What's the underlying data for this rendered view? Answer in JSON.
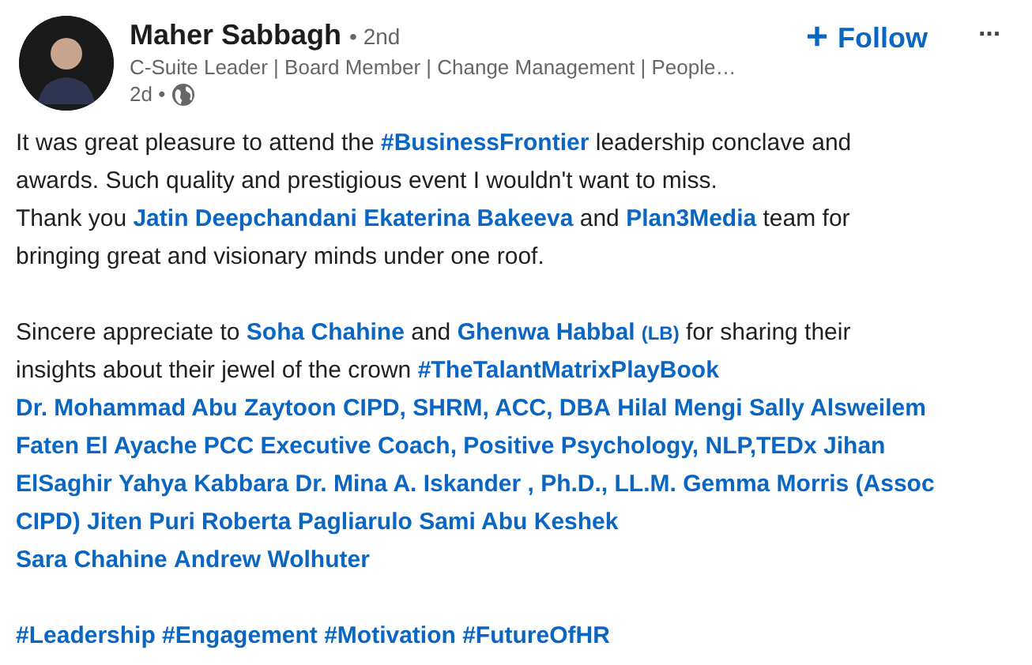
{
  "author": {
    "name": "Maher Sabbagh",
    "degree": "• 2nd",
    "headline": "C-Suite Leader | Board Member | Change Management | People…",
    "time": "2d •"
  },
  "follow": {
    "plus": "+",
    "label": "Follow"
  },
  "more": "···",
  "paragraphs": [
    {
      "lines": [
        [
          {
            "kind": "text",
            "text": "It was great pleasure to attend the "
          },
          {
            "kind": "link",
            "text": "#BusinessFrontier"
          },
          {
            "kind": "text",
            "text": " leadership conclave and"
          }
        ],
        [
          {
            "kind": "text",
            "text": "awards. Such quality and prestigious event I wouldn't want to miss."
          }
        ],
        [
          {
            "kind": "text",
            "text": "Thank you "
          },
          {
            "kind": "link",
            "text": "Jatin Deepchandani"
          },
          {
            "kind": "link",
            "text": "Ekaterina Bakeeva"
          },
          {
            "kind": "text",
            "text": " and "
          },
          {
            "kind": "link",
            "text": "Plan3Media"
          },
          {
            "kind": "text",
            "text": " team for"
          }
        ],
        [
          {
            "kind": "text",
            "text": "bringing great and visionary minds under one roof."
          }
        ]
      ]
    },
    {
      "lines": [
        [
          {
            "kind": "text",
            "text": "Sincere appreciate to "
          },
          {
            "kind": "link",
            "text": "Soha Chahine"
          },
          {
            "kind": "text",
            "text": " and "
          },
          {
            "kind": "link",
            "text": "Ghenwa Habbal"
          },
          {
            "kind": "badge",
            "text": "(LB)"
          },
          {
            "kind": "text",
            "text": " for sharing their"
          }
        ],
        [
          {
            "kind": "text",
            "text": "insights about their jewel of the crown "
          },
          {
            "kind": "link",
            "text": "#TheTalantMatrixPlayBook"
          }
        ],
        [
          {
            "kind": "link",
            "text": "Dr. Mohammad Abu Zaytoon CIPD, SHRM, ACC, DBA"
          },
          {
            "kind": "link",
            "text": "Hilal Mengi"
          },
          {
            "kind": "link",
            "text": "Sally Alsweilem"
          }
        ],
        [
          {
            "kind": "link",
            "text": "Faten El Ayache PCC Executive Coach, Positive Psychology, NLP,TEDx"
          },
          {
            "kind": "link",
            "text": "Jihan"
          }
        ],
        [
          {
            "kind": "link",
            "text": "ElSaghir"
          },
          {
            "kind": "link",
            "text": "Yahya Kabbara"
          },
          {
            "kind": "link",
            "text": "Dr. Mina A. Iskander , Ph.D., LL.M."
          },
          {
            "kind": "link",
            "text": "Gemma Morris (Assoc"
          }
        ],
        [
          {
            "kind": "link",
            "text": "CIPD)"
          },
          {
            "kind": "link",
            "text": "Jiten Puri"
          },
          {
            "kind": "link",
            "text": "Roberta Pagliarulo"
          },
          {
            "kind": "link",
            "text": "Sami Abu Keshek"
          }
        ],
        [
          {
            "kind": "link",
            "text": "Sara Chahine"
          },
          {
            "kind": "link",
            "text": "Andrew Wolhuter"
          }
        ]
      ]
    },
    {
      "lines": [
        [
          {
            "kind": "link",
            "text": "#Leadership"
          },
          {
            "kind": "link",
            "text": "#Engagement"
          },
          {
            "kind": "link",
            "text": "#Motivation"
          },
          {
            "kind": "link",
            "text": "#FutureOfHR"
          }
        ]
      ]
    }
  ]
}
